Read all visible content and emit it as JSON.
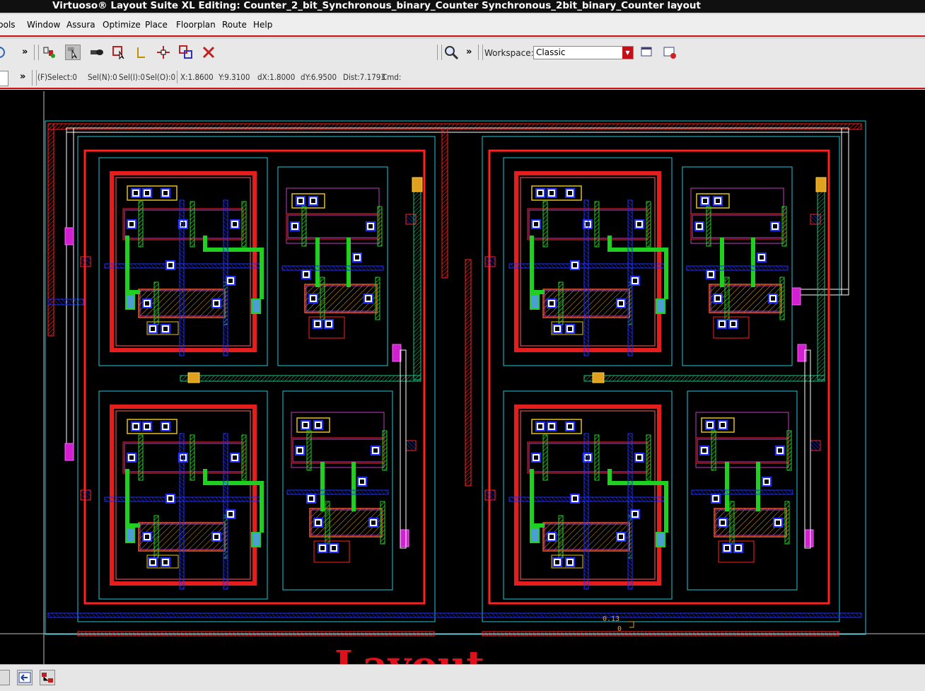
{
  "window": {
    "title": "Virtuoso® Layout Suite XL Editing: Counter_2_bit_Synchronous_binary_Counter Synchronous_2bit_binary_Counter layout"
  },
  "menu": [
    "Tools",
    "Window",
    "Assura",
    "Optimize",
    "Place",
    "Floorplan",
    "Route",
    "Help"
  ],
  "toolbar": {
    "overflow": "»",
    "workspace_label": "Workspace:",
    "workspace_value": "Classic"
  },
  "status": {
    "overflow": "»",
    "selection": "(F)Select:0",
    "sel_n": "Sel(N):0",
    "sel_i": "Sel(I):0",
    "sel_o": "Sel(O):0",
    "x": "X:1.8600",
    "y": "Y:9.3100",
    "dx": "dX:1.8000",
    "dy": "dY:6.9500",
    "dist": "Dist:7.1793",
    "cmd": "Cmd:"
  },
  "canvas": {
    "ruler_value": "0.13",
    "ruler_zero": "0"
  },
  "caption": "Layout",
  "colors": {
    "metal1": "#2030ff",
    "metal2": "#ff2020",
    "poly": "#20d020",
    "active": "#e0c020",
    "boundary": "#20c8d8",
    "accent": "#cc1111"
  }
}
